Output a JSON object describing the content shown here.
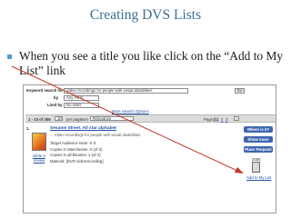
{
  "slide": {
    "title": "Creating DVS Lists",
    "bullet": "When you see a title you like click on the “Add to My List” link"
  },
  "search": {
    "keyword_label": "Keyword search for",
    "keyword_value": "Video recordings for people with visual disabilities",
    "go_label": "Go",
    "by_label": "by",
    "by_value": "Any Field",
    "limit_label": "Limit by",
    "limit_value": "No limits",
    "more_options": "More Search Options"
  },
  "results_bar": {
    "range": "1 - 10 of 356",
    "per_page_value": "10",
    "per_page_label": "per page",
    "sort_label": "Sort",
    "sort_value": "Relevance",
    "page_label": "Page:",
    "page_current": "[1]",
    "page_2": "2",
    "page_3": "3"
  },
  "result": {
    "number": "1.",
    "title": "Sesame Street. All star alphabet",
    "subtitle": "... Video recordings for people with visual disabilities",
    "write_review": "Write a review",
    "audience": "Target Audience Note: K-3",
    "copies_manchester": "Copies in Manchester: 0 (of 2)",
    "copies_in_system": "Copies in all libraries: 1 (of 2)",
    "material": "Material: [DVD videorecording]",
    "where": "Where is it?",
    "show_more": "Show more",
    "place_request": "Place Request",
    "year": "2005",
    "add_to_list": "Add to My List"
  },
  "colors": {
    "title": "#3a6f93",
    "bullet": "#4f9ccc",
    "arrow": "#c0392b",
    "side_button": "#3e66b0"
  }
}
